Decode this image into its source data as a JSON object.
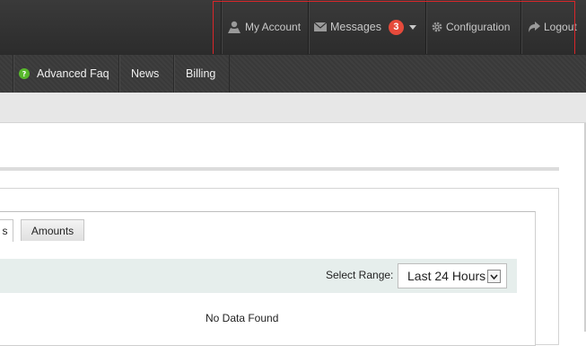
{
  "top_nav": {
    "my_account": "My Account",
    "messages": "Messages",
    "messages_count": "3",
    "configuration": "Configuration",
    "logout": "Logout"
  },
  "main_nav": {
    "advanced_faq": "Advanced Faq",
    "news": "News",
    "billing": "Billing"
  },
  "tabs": {
    "previous_partial": "s",
    "amounts": "Amounts"
  },
  "filter": {
    "label": "Select Range:",
    "selected": "Last 24 Hours"
  },
  "empty_message": "No Data Found",
  "icons": {
    "account": "user-icon",
    "messages": "envelope-icon",
    "configuration": "gear-icon",
    "logout": "share-arrow-icon",
    "faq": "help-circle-icon"
  },
  "colors": {
    "badge": "#e64a3b",
    "faq_icon": "#58b82c",
    "highlight": "#d9262a"
  }
}
